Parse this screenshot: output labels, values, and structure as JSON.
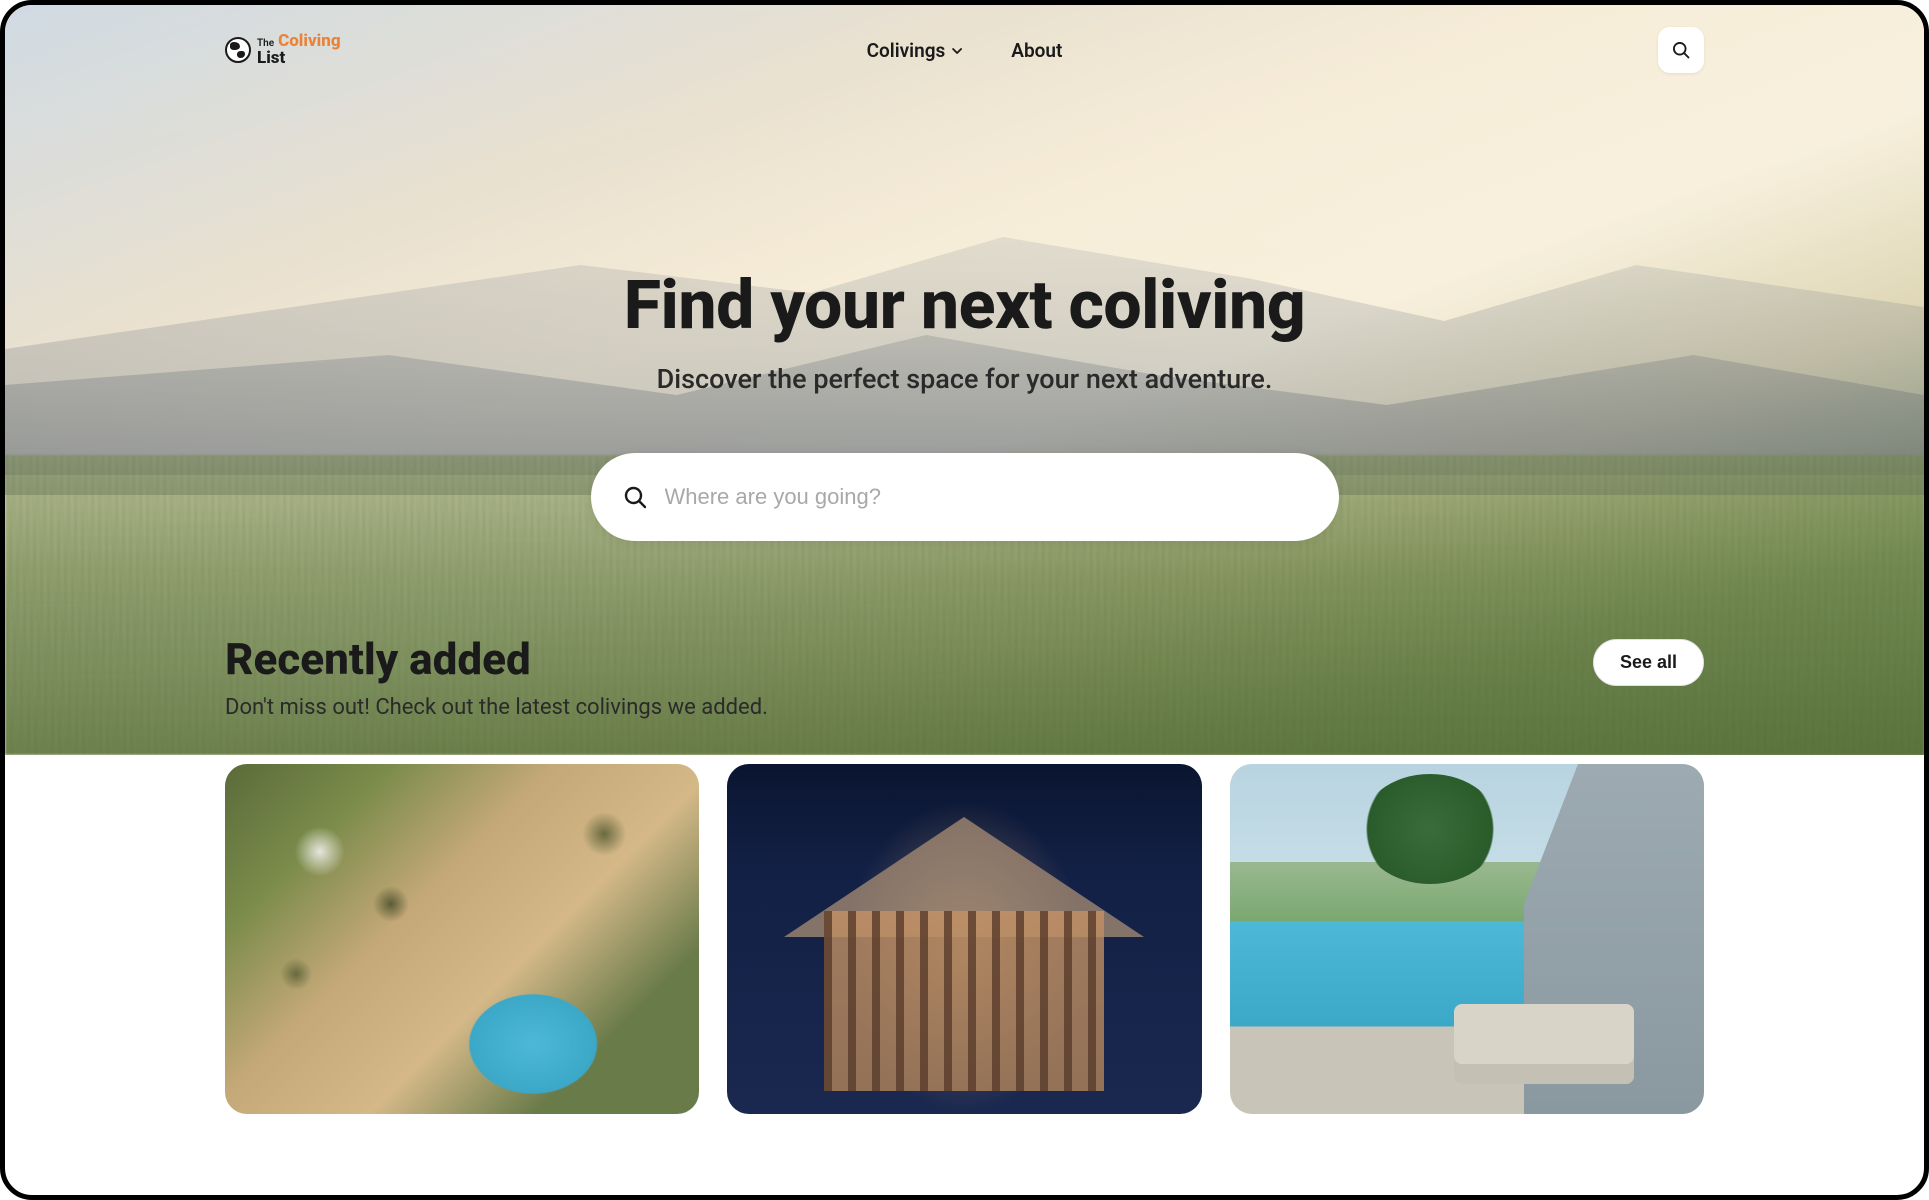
{
  "logo": {
    "the": "The",
    "coliving": "Coliving",
    "list": "List"
  },
  "nav": {
    "colivings": "Colivings",
    "about": "About"
  },
  "hero": {
    "title": "Find your next coliving",
    "subtitle": "Discover the perfect space for your next adventure.",
    "search_placeholder": "Where are you going?"
  },
  "recent": {
    "title": "Recently added",
    "subtitle": "Don't miss out! Check out the latest colivings we added.",
    "see_all": "See all"
  }
}
